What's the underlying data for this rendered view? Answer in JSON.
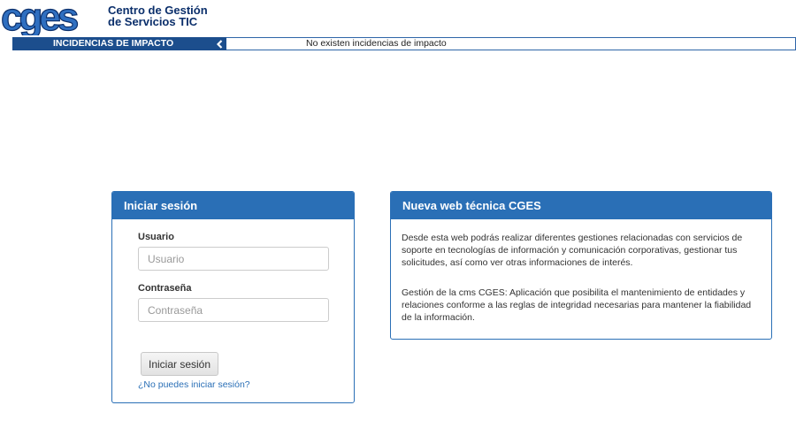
{
  "header": {
    "logo_text": "cges",
    "subtitle_line1": "Centro de Gestión",
    "subtitle_line2": "de Servicios TIC"
  },
  "incidents": {
    "label": "INCIDENCIAS DE IMPACTO",
    "message": "No existen incidencias de impacto"
  },
  "login": {
    "title": "Iniciar sesión",
    "user_label": "Usuario",
    "user_placeholder": "Usuario",
    "password_label": "Contraseña",
    "password_placeholder": "Contraseña",
    "submit_label": "Iniciar sesión",
    "forgot_link": "¿No puedes iniciar sesión?"
  },
  "news": {
    "title": "Nueva web técnica CGES",
    "paragraph1": "Desde esta web podrás realizar diferentes gestiones relacionadas con servicios de soporte en tecnologías de información y comunicación corporativas, gestionar tus solicitudes, así como ver otras informaciones de interés.",
    "paragraph2": "Gestión de la cms CGES: Aplicación que posibilita el mantenimiento de entidades y relaciones conforme a las reglas de integridad necesarias para mantener la fiabilidad de la información."
  },
  "colors": {
    "brand_blue": "#2a6fb6",
    "dark_blue": "#1c4e8d",
    "logo_navy": "#0b2f6b"
  }
}
